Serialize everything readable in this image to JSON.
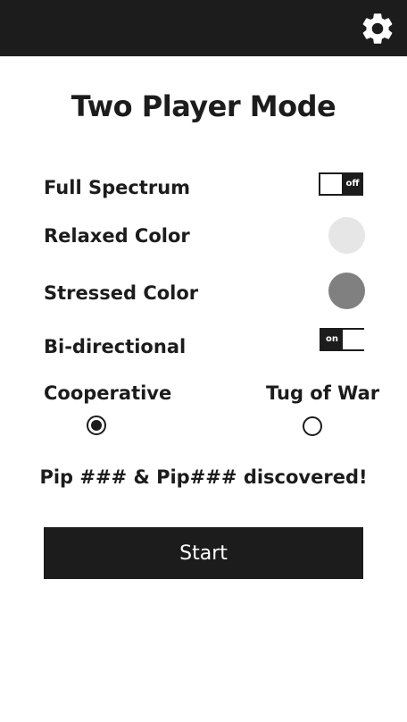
{
  "header": {
    "settings_icon": "gear-icon"
  },
  "title": "Two Player Mode",
  "options": {
    "full_spectrum": {
      "label": "Full Spectrum",
      "state": "off"
    },
    "relaxed_color": {
      "label": "Relaxed Color",
      "color": "#e6e6e6"
    },
    "stressed_color": {
      "label": "Stressed Color",
      "color": "#808080"
    },
    "bi_directional": {
      "label": "Bi-directional",
      "state": "on"
    }
  },
  "modes": {
    "cooperative": {
      "label": "Cooperative",
      "selected": true
    },
    "tug_of_war": {
      "label": "Tug of War",
      "selected": false
    }
  },
  "status": "Pip ### & Pip### discovered!",
  "start_label": "Start",
  "colors": {
    "dark": "#1c1c1c",
    "background": "#ffffff"
  }
}
